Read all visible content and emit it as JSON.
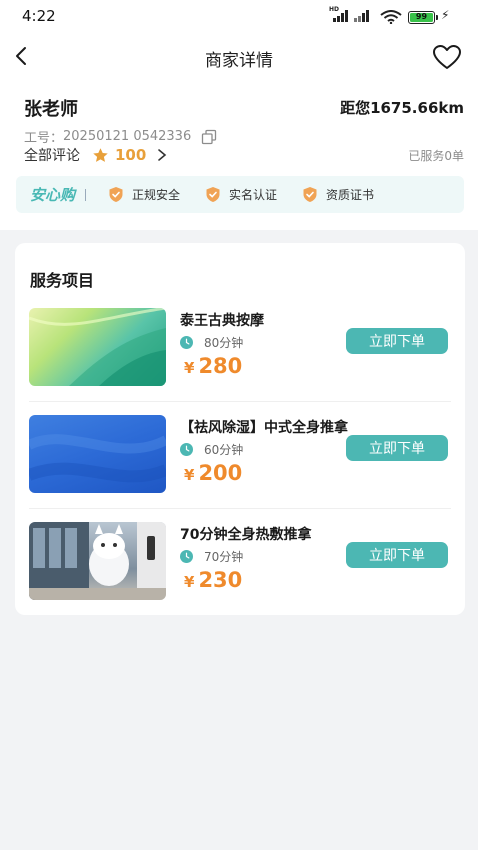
{
  "status_bar": {
    "time": "4:22",
    "battery": "99"
  },
  "nav": {
    "title": "商家详情"
  },
  "merchant": {
    "name": "张老师",
    "distance": "距您1675.66km",
    "id_label": "工号：",
    "id_value": "20250121 0542336",
    "reviews_label": "全部评论",
    "rating": "100",
    "served": "已服务0单"
  },
  "assurance": {
    "brand": "安心购",
    "badges": [
      "正规安全",
      "实名认证",
      "资质证书"
    ]
  },
  "services": {
    "heading": "服务项目",
    "items": [
      {
        "name": "泰王古典按摩",
        "duration": "80分钟",
        "currency": "¥",
        "price": "280",
        "button": "立即下单"
      },
      {
        "name": "【祛风除湿】中式全身推拿",
        "duration": "60分钟",
        "currency": "¥",
        "price": "200",
        "button": "立即下单"
      },
      {
        "name": "70分钟全身热敷推拿",
        "duration": "70分钟",
        "currency": "¥",
        "price": "230",
        "button": "立即下单"
      }
    ]
  },
  "colors": {
    "accent": "#4cb7b3",
    "price": "#ef8a2c",
    "star": "#e8a03a",
    "shield": "#f0a355"
  }
}
